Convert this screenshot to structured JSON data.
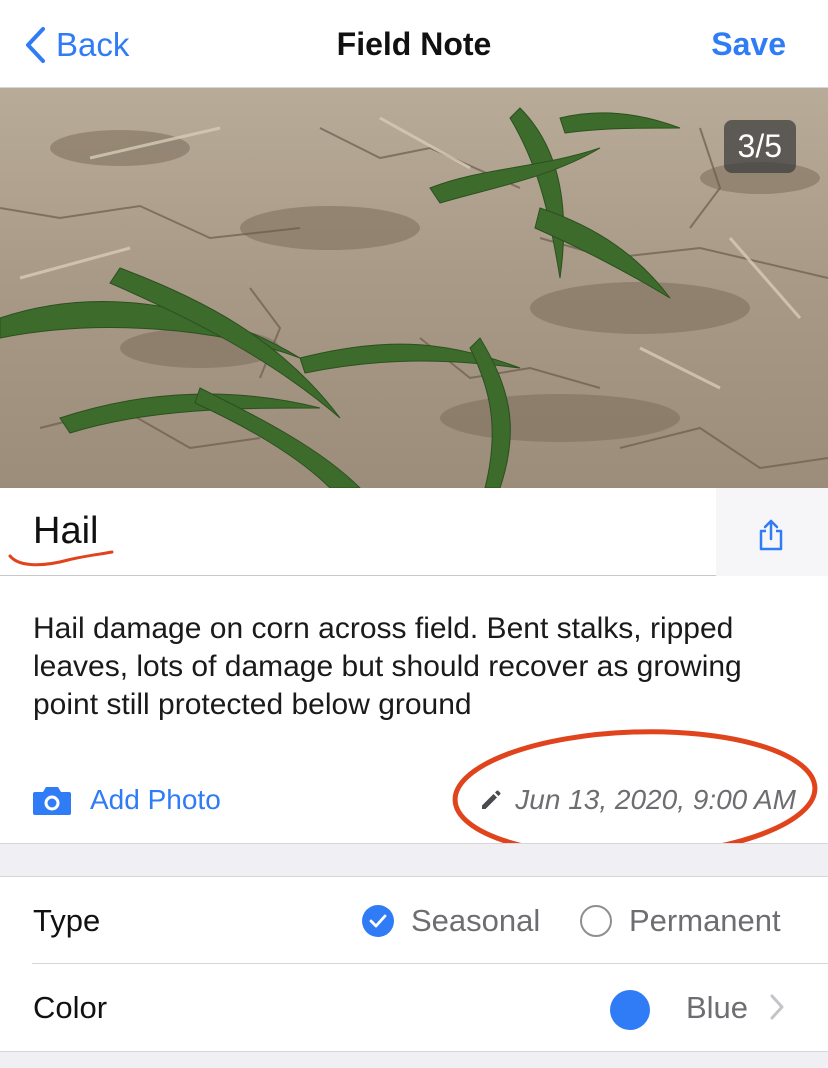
{
  "nav": {
    "back_label": "Back",
    "title": "Field Note",
    "save_label": "Save"
  },
  "photo": {
    "counter": "3/5",
    "description": "corn seedlings in cracked dry soil"
  },
  "note": {
    "title": "Hail",
    "description": "Hail damage on corn across field. Bent stalks, ripped leaves, lots of damage but should recover as growing point still protected below ground"
  },
  "actions": {
    "add_photo_label": "Add Photo",
    "date": "Jun 13, 2020, 9:00 AM"
  },
  "fields": {
    "type": {
      "label": "Type",
      "options": [
        {
          "label": "Seasonal",
          "selected": true
        },
        {
          "label": "Permanent",
          "selected": false
        }
      ]
    },
    "color": {
      "label": "Color",
      "value": "Blue",
      "swatch": "#2f7cf6"
    }
  },
  "icons": {
    "back": "chevron-left-icon",
    "share": "share-icon",
    "camera": "camera-icon",
    "edit": "pencil-icon",
    "checkmark": "checkmark-icon",
    "disclosure": "chevron-right-icon"
  },
  "colors": {
    "accent": "#2f7cf6",
    "annotation": "#e0441c",
    "secondary_text": "#6d6d72",
    "group_background": "#efeff4"
  }
}
